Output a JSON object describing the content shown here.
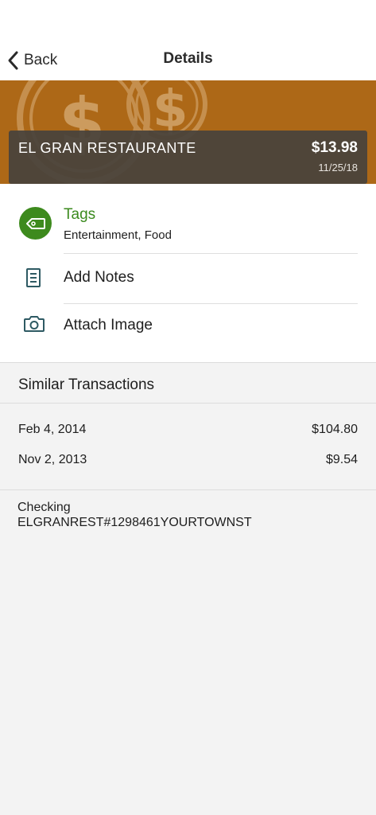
{
  "nav": {
    "back_label": "Back",
    "title": "Details"
  },
  "banner": {
    "color": "#ad6817"
  },
  "transaction": {
    "merchant": "EL GRAN RESTAURANTE",
    "amount": "$13.98",
    "date": "11/25/18"
  },
  "actions": {
    "tags_label": "Tags",
    "tags_value": "Entertainment, Food",
    "notes_label": "Add Notes",
    "image_label": "Attach Image"
  },
  "similar": {
    "header": "Similar Transactions",
    "items": [
      {
        "date": "Feb 4, 2014",
        "amount": "$104.80"
      },
      {
        "date": "Nov 2, 2013",
        "amount": "$9.54"
      }
    ]
  },
  "account": {
    "type": "Checking",
    "description": "ELGRANREST#1298461YOURTOWNST"
  },
  "colors": {
    "accent_green": "#3d8a1d",
    "icon_teal": "#2e5a63",
    "banner_brown": "#ad6817"
  },
  "icons": {
    "back": "chevron-left-icon",
    "coins": "dollar-coin-icon",
    "tags": "tag-icon",
    "notes": "document-icon",
    "image": "camera-icon"
  }
}
